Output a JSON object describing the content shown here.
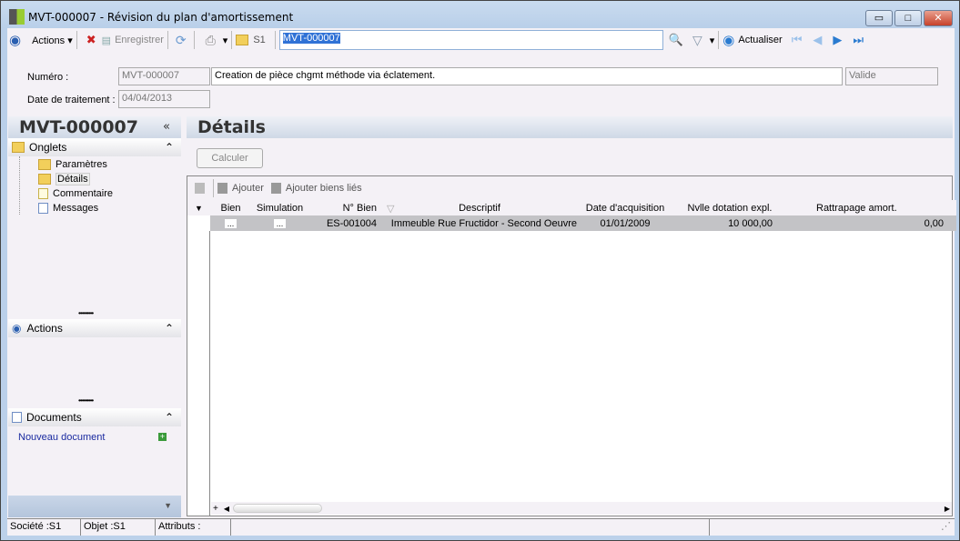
{
  "window": {
    "title": "MVT-000007 -  Révision du plan d'amortissement",
    "min": "▭",
    "max": "□",
    "close": "✕"
  },
  "toolbar": {
    "actions": "Actions",
    "save": "Enregistrer",
    "company": "S1",
    "search_value": "MVT-000007",
    "refresh": "Actualiser"
  },
  "form": {
    "numero_label": "Numéro :",
    "numero": "MVT-000007",
    "description": "Creation de pièce chgmt méthode via éclatement.",
    "status": "Valide",
    "date_label": "Date de traitement :",
    "date": "04/04/2013"
  },
  "left": {
    "title": "MVT-000007",
    "collapse": "«",
    "onglets": "Onglets",
    "tabs": [
      "Paramètres",
      "Détails",
      "Commentaire",
      "Messages"
    ],
    "actions": "Actions",
    "documents": "Documents",
    "new_document": "Nouveau document"
  },
  "main": {
    "title": "Détails",
    "calculate": "Calculer",
    "add": "Ajouter",
    "add_linked": "Ajouter biens liés",
    "columns": [
      "Bien",
      "Simulation",
      "N° Bien",
      "Descriptif",
      "Date d'acquisition",
      "Nvlle dotation expl.",
      "Rattrapage amort."
    ],
    "rows": [
      {
        "bien": "...",
        "simulation": "...",
        "num": "ES-001004",
        "desc": "Immeuble Rue Fructidor - Second Oeuvre",
        "date": "01/01/2009",
        "dotation": "10 000,00",
        "rattrapage": "0,00"
      }
    ]
  },
  "status": {
    "societe": "Société :S1",
    "objet": "Objet :S1",
    "attributs": "Attributs :"
  }
}
